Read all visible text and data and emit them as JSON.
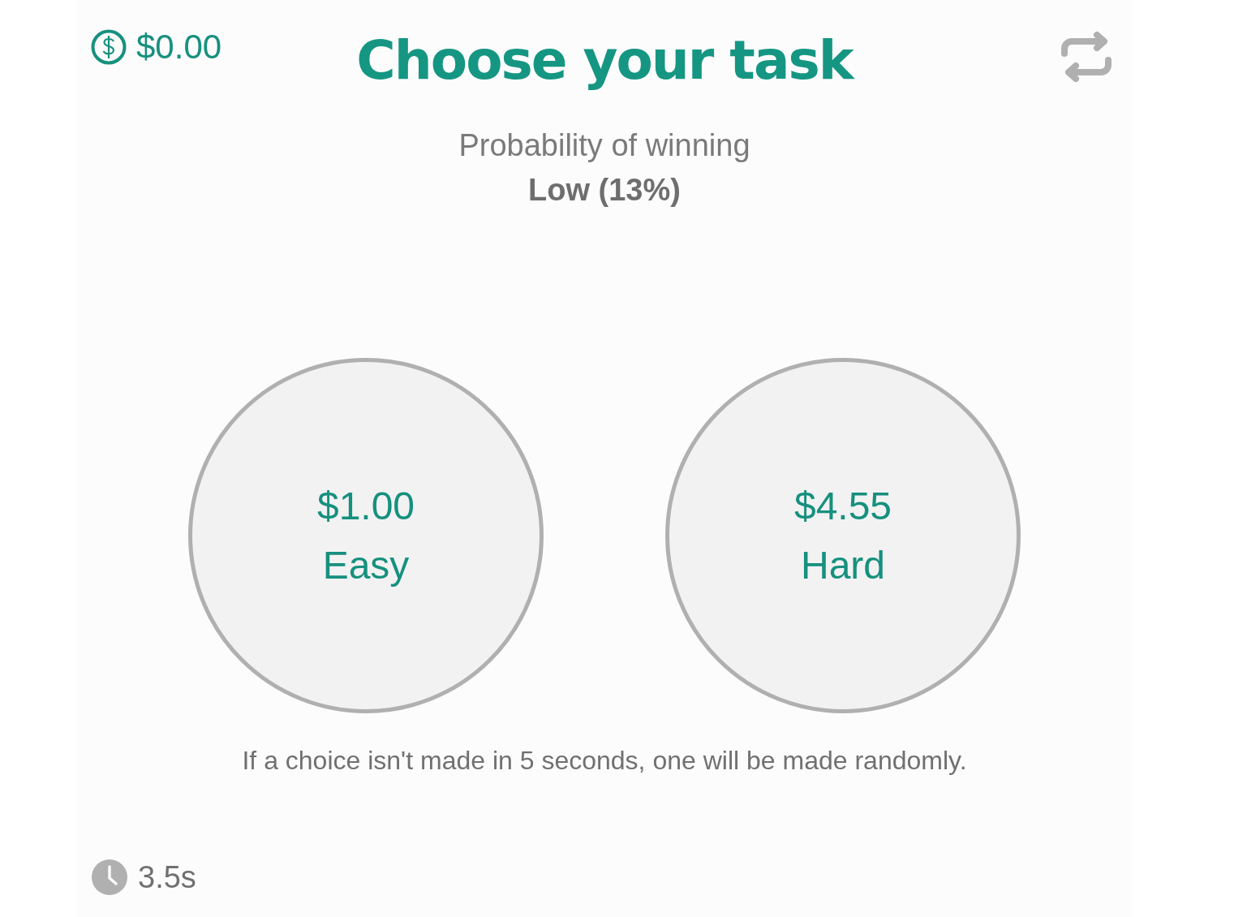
{
  "balance": "$0.00",
  "title": "Choose your task",
  "probability": {
    "label": "Probability of winning",
    "value": "Low (13%)"
  },
  "choices": [
    {
      "amount": "$1.00",
      "label": "Easy"
    },
    {
      "amount": "$4.55",
      "label": "Hard"
    }
  ],
  "note": "If a choice isn't made in 5 seconds, one will be made randomly.",
  "timer": "3.5s"
}
